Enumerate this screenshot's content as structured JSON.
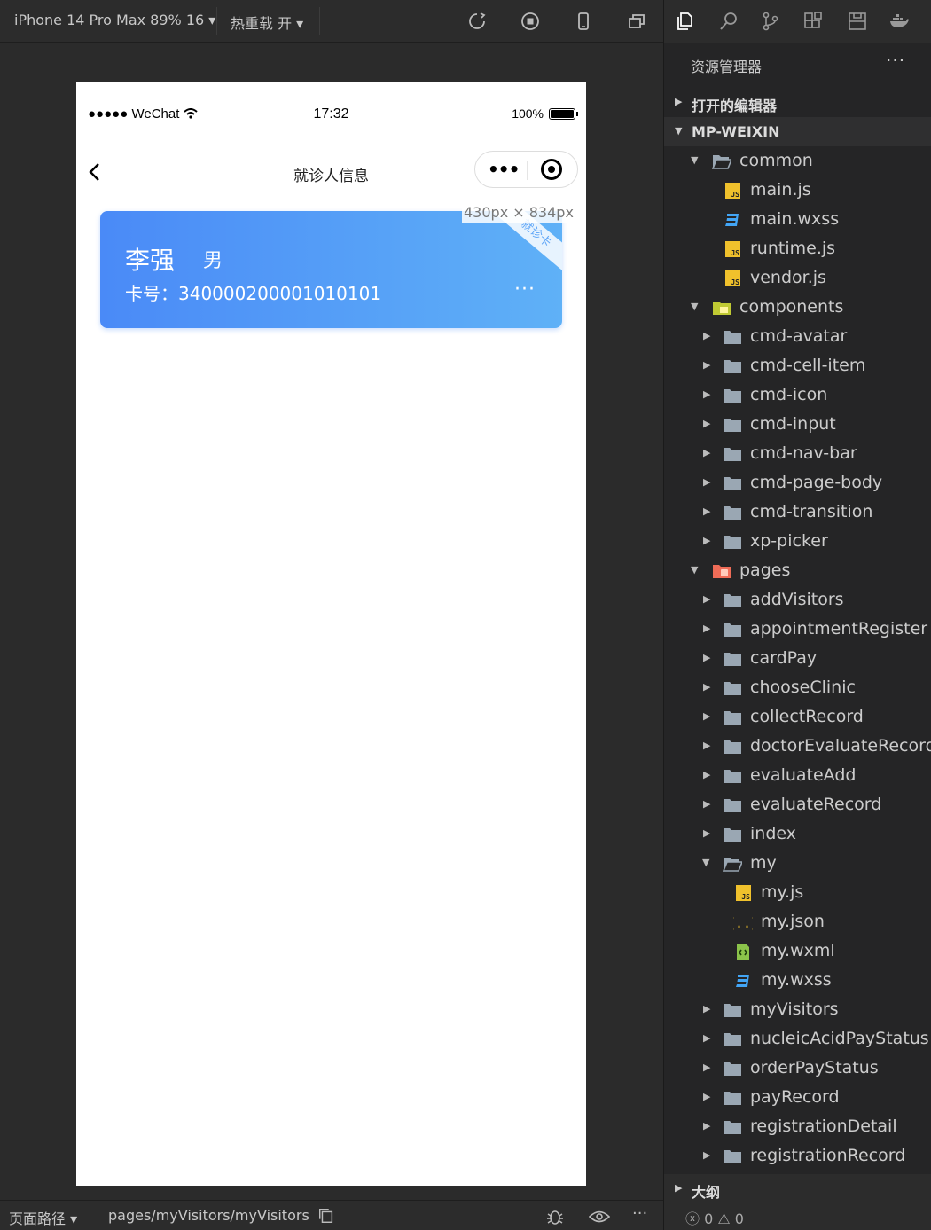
{
  "toolbar": {
    "device": "iPhone 14 Pro Max 89% 16 ▾",
    "hot_reload": "热重载 开 ▾"
  },
  "phone": {
    "signal": "●●●●● WeChat",
    "time": "17:32",
    "battery": "100%",
    "nav_title": "就诊人信息",
    "capsule_dots": "•••"
  },
  "card": {
    "name": "李强",
    "gender": "男",
    "number": "卡号：340000200001010101",
    "ribbon": "就诊卡",
    "more": "···"
  },
  "size_tip": "430px × 834px",
  "bottom": {
    "path_label": "页面路径 ▾",
    "path": "pages/myVisitors/myVisitors"
  },
  "explorer": {
    "title": "资源管理器",
    "more": "···",
    "open_editors": "打开的编辑器",
    "project": "MP-WEIXIN",
    "outline": "大纲",
    "status": "ⓧ 0 ⚠ 0",
    "tree": [
      {
        "label": "common",
        "type": "folder-open",
        "depth": 1
      },
      {
        "label": "main.js",
        "type": "js",
        "depth": 2
      },
      {
        "label": "main.wxss",
        "type": "css",
        "depth": 2
      },
      {
        "label": "runtime.js",
        "type": "js",
        "depth": 2
      },
      {
        "label": "vendor.js",
        "type": "js",
        "depth": 2
      },
      {
        "label": "components",
        "type": "folder-components",
        "depth": 1
      },
      {
        "label": "cmd-avatar",
        "type": "folder",
        "depth": 2
      },
      {
        "label": "cmd-cell-item",
        "type": "folder",
        "depth": 2
      },
      {
        "label": "cmd-icon",
        "type": "folder",
        "depth": 2
      },
      {
        "label": "cmd-input",
        "type": "folder",
        "depth": 2
      },
      {
        "label": "cmd-nav-bar",
        "type": "folder",
        "depth": 2
      },
      {
        "label": "cmd-page-body",
        "type": "folder",
        "depth": 2
      },
      {
        "label": "cmd-transition",
        "type": "folder",
        "depth": 2
      },
      {
        "label": "xp-picker",
        "type": "folder",
        "depth": 2
      },
      {
        "label": "pages",
        "type": "folder-pages",
        "depth": 1
      },
      {
        "label": "addVisitors",
        "type": "folder",
        "depth": 2
      },
      {
        "label": "appointmentRegister",
        "type": "folder",
        "depth": 2
      },
      {
        "label": "cardPay",
        "type": "folder",
        "depth": 2
      },
      {
        "label": "chooseClinic",
        "type": "folder",
        "depth": 2
      },
      {
        "label": "collectRecord",
        "type": "folder",
        "depth": 2
      },
      {
        "label": "doctorEvaluateRecord",
        "type": "folder",
        "depth": 2
      },
      {
        "label": "evaluateAdd",
        "type": "folder",
        "depth": 2
      },
      {
        "label": "evaluateRecord",
        "type": "folder",
        "depth": 2
      },
      {
        "label": "index",
        "type": "folder",
        "depth": 2
      },
      {
        "label": "my",
        "type": "folder-open",
        "depth": 2
      },
      {
        "label": "my.js",
        "type": "js",
        "depth": 3
      },
      {
        "label": "my.json",
        "type": "json",
        "depth": 3
      },
      {
        "label": "my.wxml",
        "type": "wxml",
        "depth": 3
      },
      {
        "label": "my.wxss",
        "type": "css",
        "depth": 3
      },
      {
        "label": "myVisitors",
        "type": "folder",
        "depth": 2
      },
      {
        "label": "nucleicAcidPayStatus",
        "type": "folder",
        "depth": 2
      },
      {
        "label": "orderPayStatus",
        "type": "folder",
        "depth": 2
      },
      {
        "label": "payRecord",
        "type": "folder",
        "depth": 2
      },
      {
        "label": "registrationDetail",
        "type": "folder",
        "depth": 2
      },
      {
        "label": "registrationRecord",
        "type": "folder",
        "depth": 2
      }
    ]
  }
}
